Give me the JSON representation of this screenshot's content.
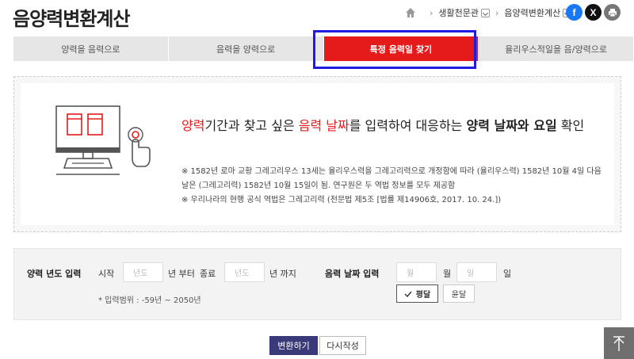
{
  "header": {
    "title": "음양력변환계산",
    "breadcrumb": [
      "생활천문관",
      "음양력변환계산"
    ],
    "share": {
      "facebook": "f",
      "x": "X",
      "print": "print"
    }
  },
  "tabs": [
    {
      "label": "양력을 음력으로",
      "active": false
    },
    {
      "label": "음력을 양력으로",
      "active": false
    },
    {
      "label": "특정 음력일 찾기",
      "active": true
    },
    {
      "label": "율리우스적일을 음/양력으로",
      "active": false
    }
  ],
  "info": {
    "headline": {
      "p1": "양력",
      "p2": "기간과 찾고 싶은 ",
      "p3": "음력 날짜",
      "p4": "를 입력하여 대응하는 ",
      "p5": "양력 날짜와 요일",
      "p6": " 확인"
    },
    "notes": [
      "※ 1582년 로마 교황 그레고리우스 13세는 율리우스력을 그레고리력으로 개정함에 따라 (율리우스력) 1582년 10월 4일 다음 날은 (그레고리력) 1582년 10월 15일이 됨. 연구원은 두 역법 정보를 모두 제공함",
      "※ 우리나라의 현행 공식 역법은 그레고리력 (천문법 제5조 [법률 제14906호, 2017. 10. 24.])"
    ]
  },
  "form": {
    "solar_year_label": "양력 년도 입력",
    "start_label": "시작",
    "start_placeholder": "년도",
    "from_suffix": "년 부터",
    "end_label": "종료",
    "end_placeholder": "년도",
    "to_suffix": "년 까지",
    "range_note": "* 입력범위 : -59년 ~ 2050년",
    "lunar_date_label": "음력 날짜 입력",
    "month_placeholder": "월",
    "month_suffix": "월",
    "day_placeholder": "일",
    "day_suffix": "일",
    "month_type_normal": "평달",
    "month_type_leap": "윤달",
    "month_type_selected": "평달"
  },
  "actions": {
    "convert": "변환하기",
    "reset": "다시작성"
  },
  "colors": {
    "accent_red": "#e51a1a",
    "primary_button": "#3a3a7a",
    "highlight_border": "#1d1ce0"
  }
}
